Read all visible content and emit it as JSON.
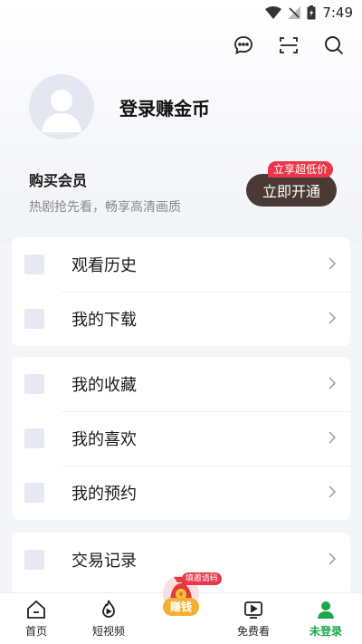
{
  "status": {
    "time": "7:49"
  },
  "profile": {
    "login_label": "登录赚金币"
  },
  "vip": {
    "title": "购买会员",
    "subtitle": "热剧抢先看，畅享高清画质",
    "badge": "立享超低价",
    "button": "立即开通"
  },
  "menu_groups": [
    {
      "items": [
        {
          "label": "观看历史"
        },
        {
          "label": "我的下载"
        }
      ]
    },
    {
      "items": [
        {
          "label": "我的收藏"
        },
        {
          "label": "我的喜欢"
        },
        {
          "label": "我的预约"
        }
      ]
    },
    {
      "items": [
        {
          "label": "交易记录"
        }
      ]
    }
  ],
  "tabs": {
    "home": "首页",
    "short_video": "短视频",
    "earn": "赚钱",
    "earn_badge": "填邀请码",
    "free": "免费看",
    "me": "未登录"
  },
  "colors": {
    "accent": "#1aa84a",
    "vip_button": "#4a3a33",
    "badge": "#e8374a"
  }
}
